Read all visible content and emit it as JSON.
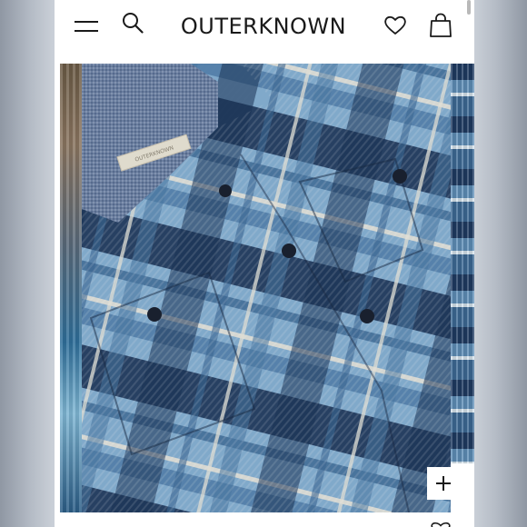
{
  "header": {
    "brand_logo": "OUTERKNOWN",
    "menu_icon": "hamburger-menu-icon",
    "search_icon": "search-icon",
    "wishlist_icon": "heart-icon",
    "cart_icon": "shopping-bag-icon"
  },
  "gallery": {
    "zoom_icon": "plus-icon",
    "shirt_label_text": "OUTERKNOWN"
  },
  "colors": {
    "header_bg": "#ffffff",
    "logo": "#1a1a1a",
    "plaid_navy": "#1c3458",
    "plaid_mid_blue": "#5f8fb8",
    "plaid_light_blue": "#9cc3df",
    "plaid_cream": "#e8e6dc",
    "collar_chambray": "#6f84a6"
  }
}
